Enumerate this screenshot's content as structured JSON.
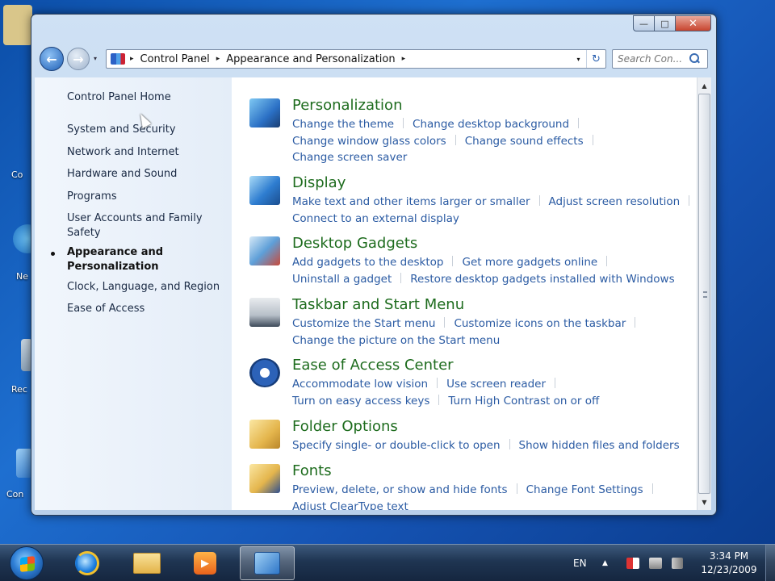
{
  "desktop": {
    "icons": [
      {
        "label": "Co",
        "icon": "computer-icon",
        "color": "#d9c68a"
      },
      {
        "label": "Ne",
        "icon": "network-icon",
        "color": "#3a8fd8"
      },
      {
        "label": "Rec",
        "icon": "recycle-bin-icon",
        "color": "#9bb3c9"
      },
      {
        "label": "Con",
        "icon": "control-panel-icon",
        "color": "#5ba0dc"
      }
    ]
  },
  "window": {
    "caption": {
      "minimize": "—",
      "maximize": "□",
      "close": "✕"
    },
    "nav": {
      "back": "←",
      "forward": "→",
      "recent": "▾"
    },
    "address": {
      "crumbs": [
        "Control Panel",
        "Appearance and Personalization"
      ],
      "separator": "▸",
      "dropdown": "▾",
      "refresh": "↻"
    },
    "search": {
      "placeholder": "Search Con..."
    }
  },
  "left_nav": {
    "items": [
      {
        "label": "Control Panel Home",
        "current": false
      },
      {
        "label": "System and Security",
        "current": false
      },
      {
        "label": "Network and Internet",
        "current": false
      },
      {
        "label": "Hardware and Sound",
        "current": false
      },
      {
        "label": "Programs",
        "current": false
      },
      {
        "label": "User Accounts and Family Safety",
        "current": false
      },
      {
        "label": "Appearance and Personalization",
        "current": true
      },
      {
        "label": "Clock, Language, and Region",
        "current": false
      },
      {
        "label": "Ease of Access",
        "current": false
      }
    ]
  },
  "categories": [
    {
      "title": "Personalization",
      "icon": "personalization-icon",
      "links": [
        [
          "Change the theme",
          "Change desktop background"
        ],
        [
          "Change window glass colors",
          "Change sound effects"
        ],
        [
          "Change screen saver"
        ]
      ]
    },
    {
      "title": "Display",
      "icon": "display-icon",
      "links": [
        [
          "Make text and other items larger or smaller",
          "Adjust screen resolution"
        ],
        [
          "Connect to an external display"
        ]
      ]
    },
    {
      "title": "Desktop Gadgets",
      "icon": "desktop-gadgets-icon",
      "links": [
        [
          "Add gadgets to the desktop",
          "Get more gadgets online"
        ],
        [
          "Uninstall a gadget",
          "Restore desktop gadgets installed with Windows"
        ]
      ]
    },
    {
      "title": "Taskbar and Start Menu",
      "icon": "taskbar-icon",
      "links": [
        [
          "Customize the Start menu",
          "Customize icons on the taskbar"
        ],
        [
          "Change the picture on the Start menu"
        ]
      ]
    },
    {
      "title": "Ease of Access Center",
      "icon": "ease-of-access-icon",
      "links": [
        [
          "Accommodate low vision",
          "Use screen reader"
        ],
        [
          "Turn on easy access keys",
          "Turn High Contrast on or off"
        ]
      ]
    },
    {
      "title": "Folder Options",
      "icon": "folder-options-icon",
      "links": [
        [
          "Specify single- or double-click to open",
          "Show hidden files and folders"
        ]
      ]
    },
    {
      "title": "Fonts",
      "icon": "fonts-icon",
      "links": [
        [
          "Preview, delete, or show and hide fonts",
          "Change Font Settings"
        ],
        [
          "Adjust ClearType text"
        ]
      ]
    }
  ],
  "scrollbar": {
    "up": "▲",
    "down": "▼"
  },
  "taskbar": {
    "language": "EN",
    "tray_arrow": "▲",
    "clock": {
      "time": "3:34 PM",
      "date": "12/23/2009"
    }
  },
  "colors": {
    "link": "#2b5ba3",
    "category_title": "#1e6c1e"
  }
}
